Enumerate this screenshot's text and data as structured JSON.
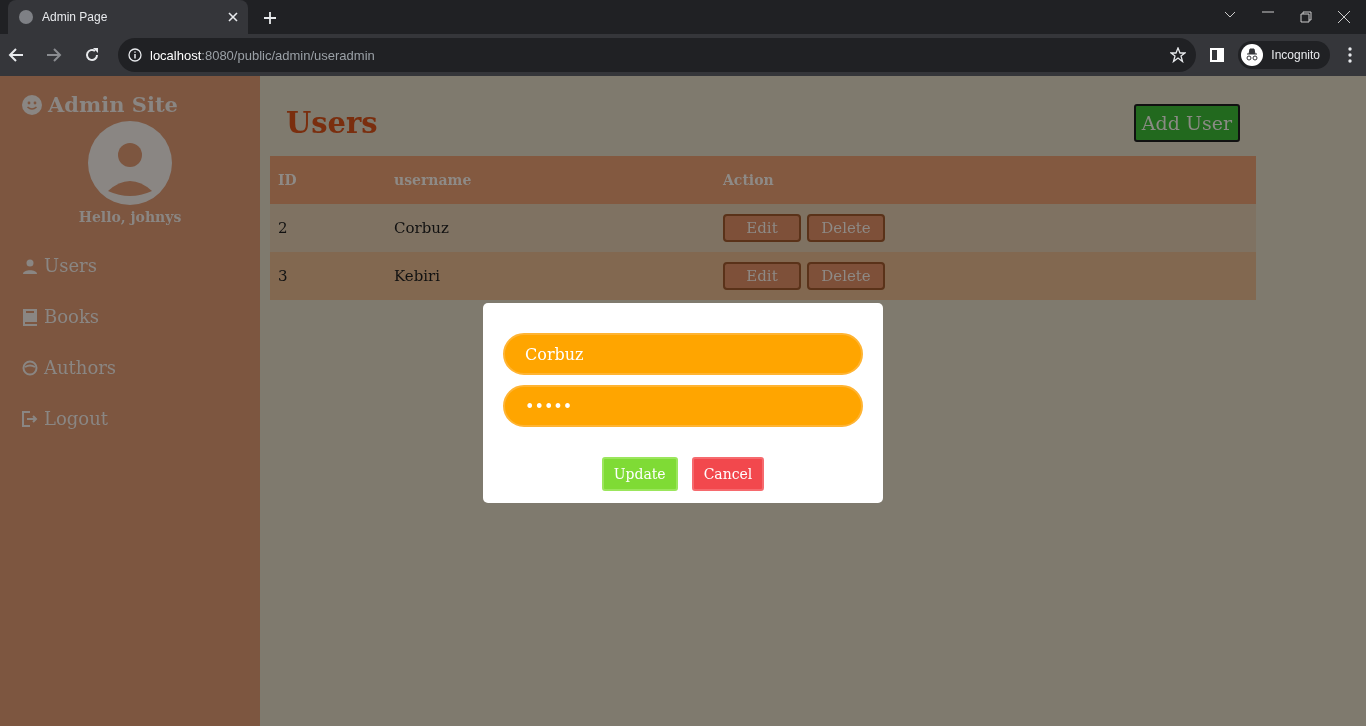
{
  "browser": {
    "tab_title": "Admin Page",
    "url_host": "localhost",
    "url_path": ":8080/public/admin/useradmin",
    "profile": "Incognito"
  },
  "sidebar": {
    "title": "Admin Site",
    "greeting": "Hello, johnys",
    "items": [
      {
        "label": "Users",
        "kind": "user"
      },
      {
        "label": "Books",
        "kind": "book"
      },
      {
        "label": "Authors",
        "kind": "face"
      },
      {
        "label": "Logout",
        "kind": "logout"
      }
    ]
  },
  "main": {
    "heading": "Users",
    "add_button": "Add User",
    "table": {
      "columns": [
        "ID",
        "username",
        "Action"
      ],
      "rows": [
        {
          "id": "2",
          "username": "Corbuz",
          "actions": [
            "Edit",
            "Delete"
          ]
        },
        {
          "id": "3",
          "username": "Kebiri",
          "actions": [
            "Edit",
            "Delete"
          ]
        }
      ]
    }
  },
  "modal": {
    "username": "Corbuz",
    "password": "•••••",
    "buttons": [
      {
        "label": "Update",
        "kind": "confirm"
      },
      {
        "label": "Cancel",
        "kind": "cancel"
      }
    ]
  }
}
